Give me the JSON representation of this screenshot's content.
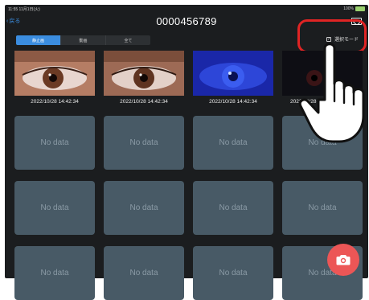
{
  "status_bar": {
    "time_date": "11:55 11月1日(火)",
    "battery": "100%"
  },
  "header": {
    "back_label": "戻る",
    "title": "0000456789"
  },
  "segments": [
    {
      "label": "静止画",
      "active": true
    },
    {
      "label": "動画",
      "active": false
    },
    {
      "label": "全て",
      "active": false
    }
  ],
  "select_mode": {
    "label": "選択モード",
    "checked": true
  },
  "photos": [
    {
      "timestamp": "2022/10/28 14:42:34",
      "style": "natural"
    },
    {
      "timestamp": "2022/10/28 14:42:34",
      "style": "natural"
    },
    {
      "timestamp": "2022/10/28 14:42:34",
      "style": "blue"
    },
    {
      "timestamp": "2022/10/28 14:42:34",
      "style": "dark"
    }
  ],
  "no_data_label": "No data",
  "colors": {
    "accent": "#3b8de0",
    "highlight_ring": "#e02424",
    "camera_button": "#ec5656",
    "tile": "#485a66"
  },
  "icons": {
    "camera": "camera-icon",
    "mail": "mail-icon",
    "back": "chevron-left-icon"
  }
}
